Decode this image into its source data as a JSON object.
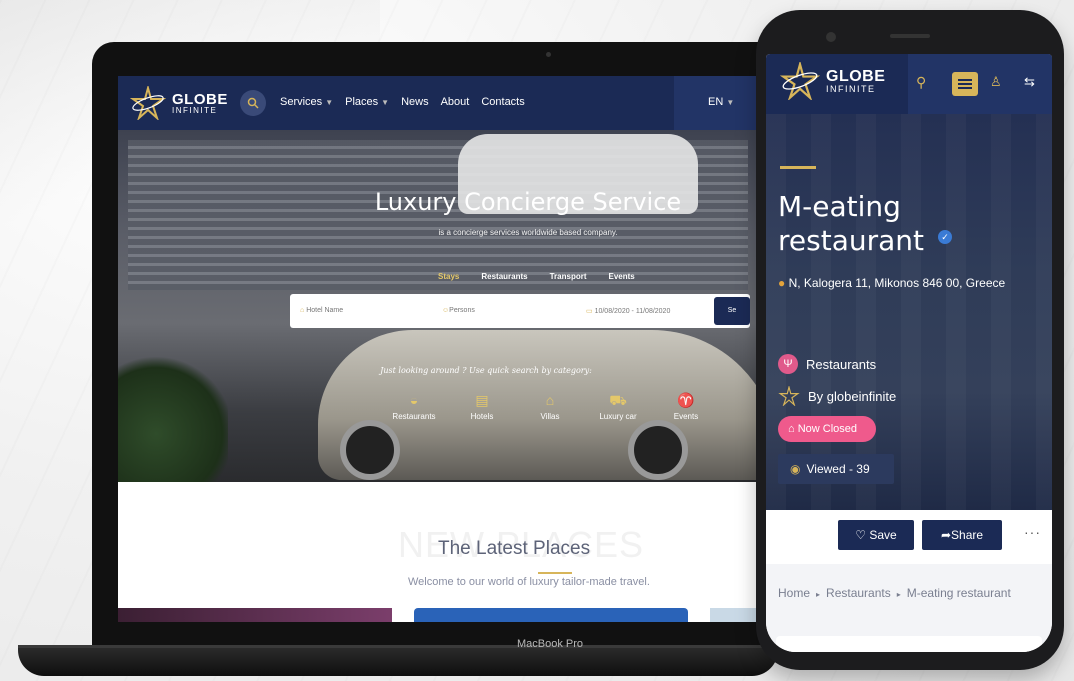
{
  "laptop": {
    "label": "MacBook Pro",
    "site": {
      "logo": {
        "line1": "GLOBE",
        "line2": "INFINITE"
      },
      "nav": [
        {
          "label": "Services",
          "dropdown": true
        },
        {
          "label": "Places",
          "dropdown": true
        },
        {
          "label": "News",
          "dropdown": false
        },
        {
          "label": "About",
          "dropdown": false
        },
        {
          "label": "Contacts",
          "dropdown": false
        }
      ],
      "lang": "EN",
      "hero": {
        "title": "Luxury Concierge Service",
        "subtitle": "is a concierge services worldwide based company.",
        "tabs": [
          "Stays",
          "Restaurants",
          "Transport",
          "Events"
        ],
        "active_tab": "Stays",
        "search": {
          "hotel_placeholder": "Hotel Name",
          "persons_placeholder": "Persons",
          "dates": "10/08/2020 - 11/08/2020",
          "button": "Se"
        },
        "quick_search": "Just looking around ? Use quick search by category:",
        "categories": [
          "Restaurants",
          "Hotels",
          "Villas",
          "Luxury car",
          "Events"
        ]
      },
      "section": {
        "bg_text": "NEW PLACES",
        "title": "The Latest Places",
        "subtitle": "Welcome to our world of luxury tailor-made travel."
      }
    }
  },
  "phone": {
    "logo": {
      "line1": "GLOBE",
      "line2": "INFINITE"
    },
    "title": "M-eating restaurant",
    "address": "N, Kalogera 11, Mikonos 846 00, Greece",
    "category": "Restaurants",
    "author": "By globeinfinite",
    "status": "Now Closed",
    "viewed": "Viewed - 39",
    "actions": {
      "save": "Save",
      "share": "Share",
      "more": "···"
    },
    "breadcrumb": {
      "home": "Home",
      "category": "Restaurants",
      "current": "M-eating restaurant"
    },
    "colors": {
      "navy": "#1b2a55",
      "gold": "#d7b55a",
      "pink": "#ef5a8c"
    }
  }
}
